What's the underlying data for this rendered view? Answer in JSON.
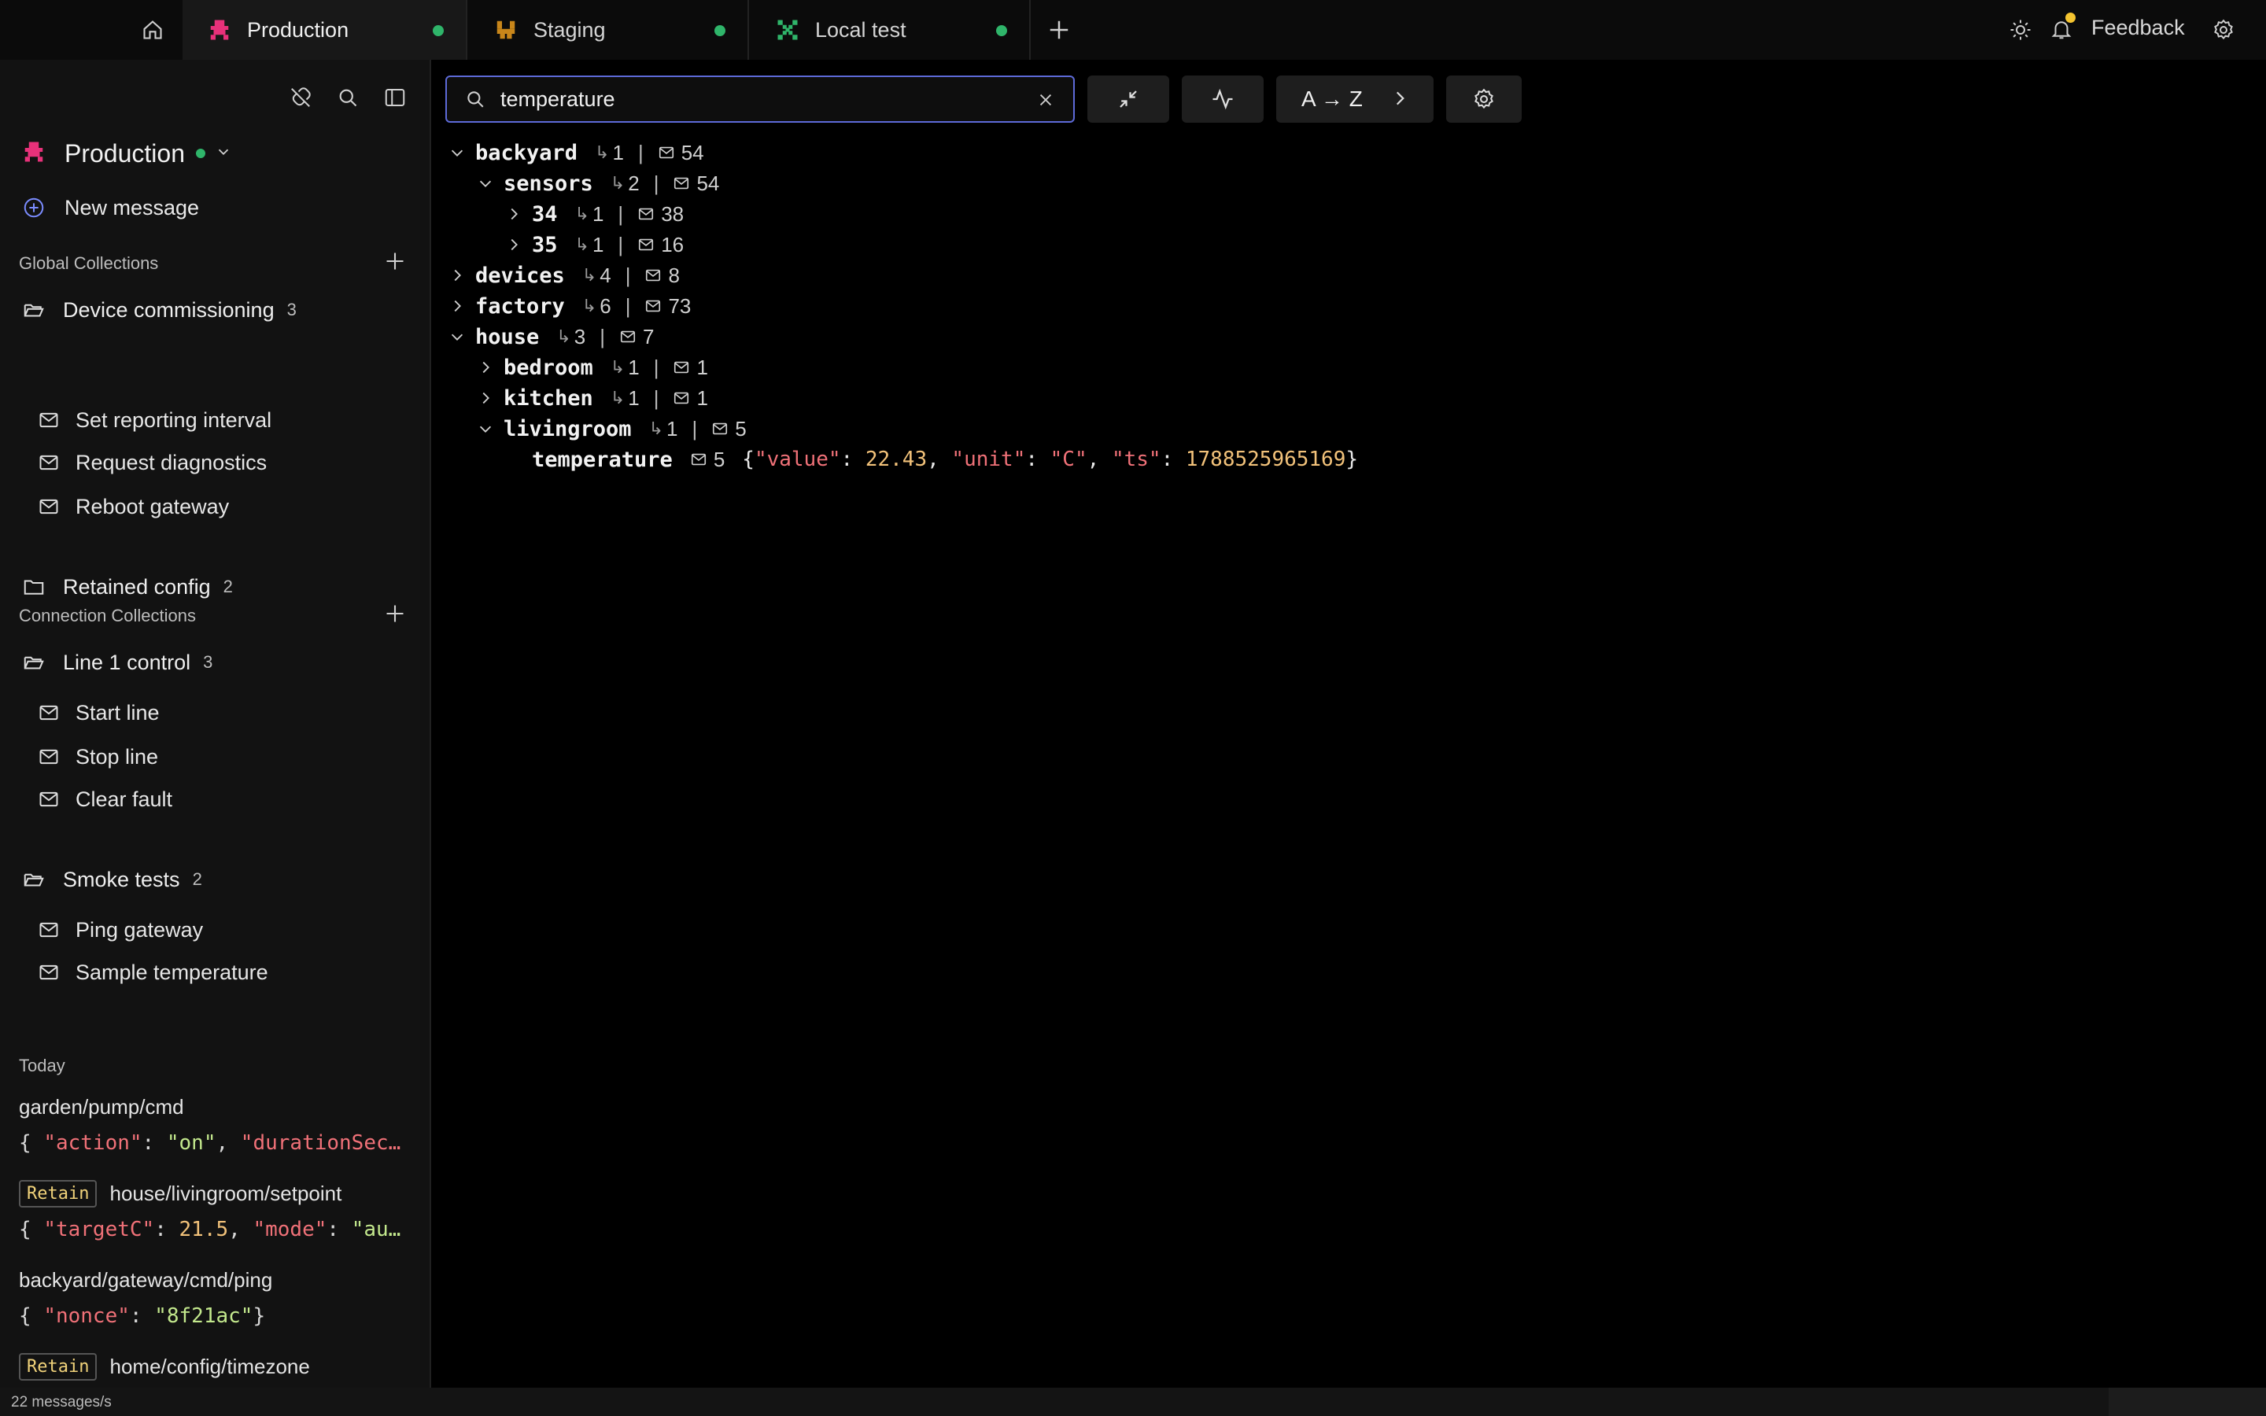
{
  "tabs": [
    {
      "label": "Production",
      "status_color": "#2fb56a"
    },
    {
      "label": "Staging",
      "status_color": "#2fb56a"
    },
    {
      "label": "Local test",
      "status_color": "#2fb56a"
    }
  ],
  "topbar": {
    "feedback_label": "Feedback"
  },
  "sidebar": {
    "connection": {
      "name": "Production"
    },
    "new_message_label": "New message",
    "global_collections": {
      "title": "Global Collections",
      "folders": [
        {
          "label": "Device commissioning",
          "count": "3",
          "items": [
            "Set reporting interval",
            "Request diagnostics",
            "Reboot gateway"
          ]
        },
        {
          "label": "Retained config",
          "count": "2"
        }
      ]
    },
    "connection_collections": {
      "title": "Connection Collections",
      "folders": [
        {
          "label": "Line 1 control",
          "count": "3",
          "items": [
            "Start line",
            "Stop line",
            "Clear fault"
          ]
        },
        {
          "label": "Smoke tests",
          "count": "2",
          "items": [
            "Ping gateway",
            "Sample temperature"
          ]
        }
      ]
    },
    "history": {
      "title": "Today",
      "entries": [
        {
          "topic": "garden/pump/cmd",
          "retain": false,
          "payload": "{ \"action\": \"on\", \"durationSec…"
        },
        {
          "topic": "house/livingroom/setpoint",
          "retain": true,
          "payload": "{ \"targetC\": 21.5, \"mode\": \"au…"
        },
        {
          "topic": "backyard/gateway/cmd/ping",
          "retain": false,
          "payload": "{ \"nonce\": \"8f21ac\"}"
        },
        {
          "topic": "home/config/timezone",
          "retain": true
        }
      ],
      "retain_label": "Retain"
    }
  },
  "status": {
    "rate": "22 messages/s"
  },
  "toolbar": {
    "search_value": "temperature",
    "sort_label": "A → Z"
  },
  "tree": [
    {
      "name": "backyard",
      "subtopics": "1",
      "messages": "54",
      "expanded": true
    },
    {
      "name": "sensors",
      "subtopics": "2",
      "messages": "54",
      "expanded": true
    },
    {
      "name": "34",
      "subtopics": "1",
      "messages": "38",
      "expanded": false
    },
    {
      "name": "35",
      "subtopics": "1",
      "messages": "16",
      "expanded": false
    },
    {
      "name": "devices",
      "subtopics": "4",
      "messages": "8",
      "expanded": false
    },
    {
      "name": "factory",
      "subtopics": "6",
      "messages": "73",
      "expanded": false
    },
    {
      "name": "house",
      "subtopics": "3",
      "messages": "7",
      "expanded": true
    },
    {
      "name": "bedroom",
      "subtopics": "1",
      "messages": "1",
      "expanded": false
    },
    {
      "name": "kitchen",
      "subtopics": "1",
      "messages": "1",
      "expanded": false
    },
    {
      "name": "livingroom",
      "subtopics": "1",
      "messages": "5",
      "expanded": true
    },
    {
      "name": "temperature",
      "messages": "5",
      "payload": {
        "value": "22.43",
        "unit": "\"C\"",
        "ts": "1788525965169"
      }
    }
  ]
}
